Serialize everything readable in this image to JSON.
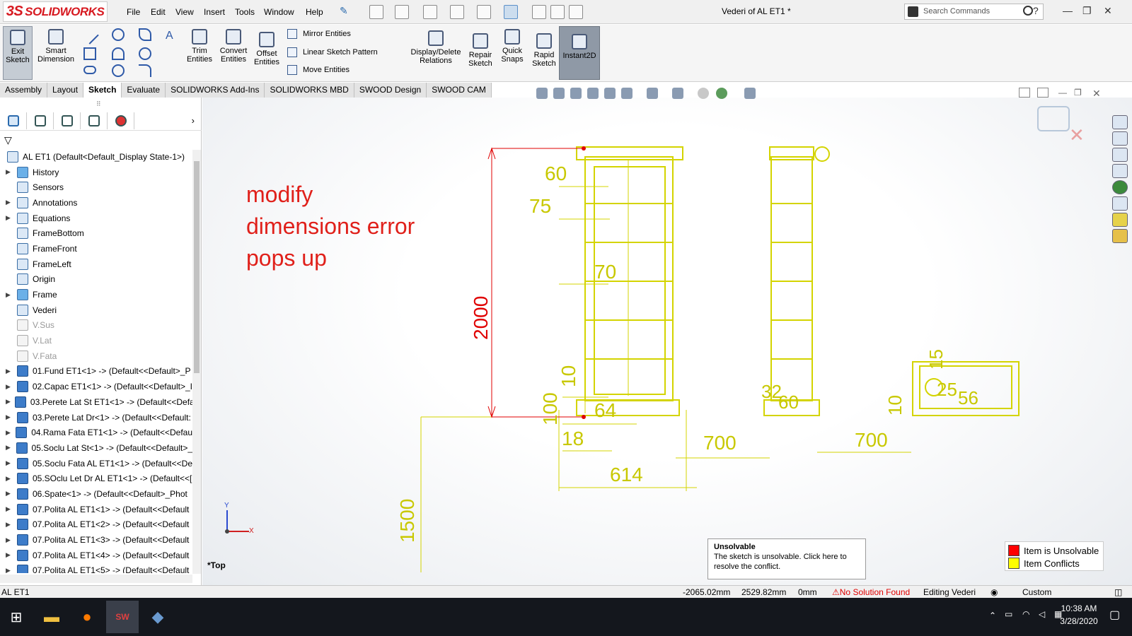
{
  "app": {
    "brand": "SOLIDWORKS",
    "brand_mark": "3S",
    "doc_title": "Vederi of AL ET1 *",
    "search_placeholder": "Search Commands",
    "help_label": "?"
  },
  "menu": [
    "File",
    "Edit",
    "View",
    "Insert",
    "Tools",
    "Window",
    "Help"
  ],
  "commands": {
    "exit_sketch": "Exit\nSketch",
    "smart_dimension": "Smart\nDimension",
    "trim_entities": "Trim\nEntities",
    "convert_entities": "Convert\nEntities",
    "offset_entities": "Offset\nEntities",
    "mirror_entities": "Mirror Entities",
    "linear_pattern": "Linear Sketch Pattern",
    "move_entities": "Move Entities",
    "display_relations": "Display/Delete\nRelations",
    "repair_sketch": "Repair\nSketch",
    "quick_snaps": "Quick\nSnaps",
    "rapid_sketch": "Rapid\nSketch",
    "instant2d": "Instant2D"
  },
  "tabs": [
    "Assembly",
    "Layout",
    "Sketch",
    "Evaluate",
    "SOLIDWORKS Add-Ins",
    "SOLIDWORKS MBD",
    "SWOOD Design",
    "SWOOD CAM"
  ],
  "selected_tab": "Sketch",
  "tree": [
    {
      "label": "AL ET1  (Default<Default_Display State-1>)",
      "type": "root"
    },
    {
      "label": "History",
      "type": "folder",
      "expand": true
    },
    {
      "label": "Sensors",
      "type": "item"
    },
    {
      "label": "Annotations",
      "type": "item",
      "expand": true
    },
    {
      "label": "Equations",
      "type": "item",
      "expand": true
    },
    {
      "label": "FrameBottom",
      "type": "item"
    },
    {
      "label": "FrameFront",
      "type": "item"
    },
    {
      "label": "FrameLeft",
      "type": "item"
    },
    {
      "label": "Origin",
      "type": "item"
    },
    {
      "label": "Frame",
      "type": "folder",
      "expand": true
    },
    {
      "label": "Vederi",
      "type": "item"
    },
    {
      "label": "V.Sus",
      "type": "grey"
    },
    {
      "label": "V.Lat",
      "type": "grey"
    },
    {
      "label": "V.Fata",
      "type": "grey"
    },
    {
      "label": "01.Fund ET1<1> -> (Default<<Default>_P",
      "type": "part",
      "expand": true
    },
    {
      "label": "02.Capac ET1<1> -> (Default<<Default>_I",
      "type": "part",
      "expand": true
    },
    {
      "label": "03.Perete Lat St ET1<1> -> (Default<<Defa",
      "type": "part",
      "expand": true
    },
    {
      "label": "03.Perete Lat Dr<1> -> (Default<<Default:",
      "type": "part",
      "expand": true
    },
    {
      "label": "04.Rama Fata ET1<1> -> (Default<<Defau",
      "type": "part",
      "expand": true
    },
    {
      "label": "05.Soclu Lat St<1> -> (Default<<Default>_",
      "type": "part",
      "expand": true
    },
    {
      "label": "05.Soclu Fata AL ET1<1> -> (Default<<De",
      "type": "part",
      "expand": true
    },
    {
      "label": "05.SOclu Let Dr AL ET1<1> -> (Default<<[",
      "type": "part",
      "expand": true
    },
    {
      "label": "06.Spate<1> -> (Default<<Default>_Phot",
      "type": "part",
      "expand": true
    },
    {
      "label": "07.Polita AL ET1<1> -> (Default<<Default",
      "type": "part",
      "expand": true
    },
    {
      "label": "07.Polita AL ET1<2> -> (Default<<Default",
      "type": "part",
      "expand": true
    },
    {
      "label": "07.Polita AL ET1<3> -> (Default<<Default",
      "type": "part",
      "expand": true
    },
    {
      "label": "07.Polita AL ET1<4> -> (Default<<Default",
      "type": "part",
      "expand": true
    },
    {
      "label": "07.Polita AL ET1<5> -> (Default<<Default",
      "type": "part",
      "expand": true
    }
  ],
  "canvas": {
    "annotation": [
      "modify",
      "dimensions error",
      "pops up"
    ],
    "view_label": "*Top",
    "axis_x": "X",
    "axis_y": "Y",
    "dims": {
      "d2000": "2000",
      "d60": "60",
      "d75": "75",
      "d70": "70",
      "d10a": "10",
      "d100": "100",
      "d64": "64",
      "d18": "18",
      "d614": "614",
      "d700a": "700",
      "d700b": "700",
      "d1500": "1500",
      "d32": "32",
      "d60b": "60",
      "d15": "15",
      "d25": "25",
      "d56": "56",
      "d10b": "10"
    }
  },
  "tooltip": {
    "title": "Unsolvable",
    "text": "The sketch is unsolvable. Click here to resolve the conflict."
  },
  "legend": [
    {
      "label": "Item is Unsolvable",
      "color": "#ff0000"
    },
    {
      "label": "Item Conflicts",
      "color": "#ffff00"
    }
  ],
  "status": {
    "name": "AL ET1",
    "x": "-2065.02mm",
    "y": "2529.82mm",
    "z": "0mm",
    "solution": "No Solution Found",
    "editing": "Editing Vederi",
    "units": "Custom"
  },
  "taskbar": {
    "time": "10:38 AM",
    "date": "3/28/2020"
  },
  "colors": {
    "sketch_yellow": "#d4d400",
    "error_red": "#e00000",
    "annotation_red": "#e0201a"
  }
}
